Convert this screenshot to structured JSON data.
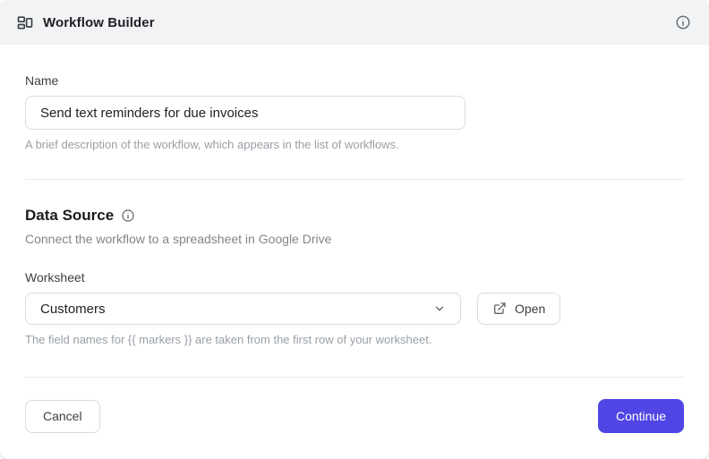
{
  "header": {
    "title": "Workflow Builder"
  },
  "name_section": {
    "label": "Name",
    "input_value": "Send text reminders for due invoices",
    "helper": "A brief description of the workflow, which appears in the list of workflows."
  },
  "data_source_section": {
    "heading": "Data Source",
    "subtitle": "Connect the workflow to a spreadsheet in Google Drive",
    "worksheet_label": "Worksheet",
    "worksheet_value": "Customers",
    "open_label": "Open",
    "helper": "The field names for {{ markers }} are taken from the first row of your worksheet."
  },
  "footer": {
    "cancel_label": "Cancel",
    "continue_label": "Continue"
  },
  "colors": {
    "accent": "#4f46e5",
    "header_bg": "#f1f3f4"
  }
}
